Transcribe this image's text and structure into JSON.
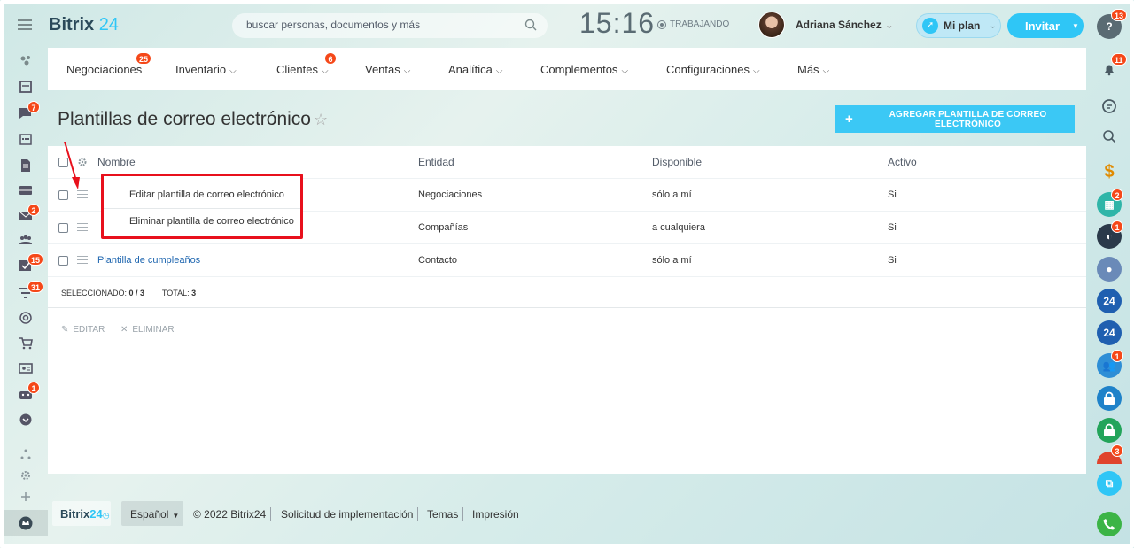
{
  "header": {
    "logo_text": "Bitrix",
    "logo_num": "24",
    "search_placeholder": "buscar personas, documentos y más",
    "clock": "15:16",
    "status": "TRABAJANDO",
    "user_name": "Adriana Sánchez",
    "plan_label": "Mi plan",
    "invite_label": "Invitar"
  },
  "nav": {
    "items": [
      {
        "label": "Negociaciones",
        "badge": "25"
      },
      {
        "label": "Inventario",
        "badge": ""
      },
      {
        "label": "Clientes",
        "badge": "6"
      },
      {
        "label": "Ventas",
        "badge": ""
      },
      {
        "label": "Analítica",
        "badge": ""
      },
      {
        "label": "Complementos",
        "badge": ""
      },
      {
        "label": "Configuraciones",
        "badge": ""
      },
      {
        "label": "Más",
        "badge": ""
      }
    ]
  },
  "page": {
    "title": "Plantillas de correo electrónico",
    "add_button": "AGREGAR PLANTILLA DE CORREO ELECTRÓNICO"
  },
  "grid": {
    "columns": [
      "Nombre",
      "Entidad",
      "Disponible",
      "Activo"
    ],
    "rows": [
      {
        "name": "",
        "entity": "Negociaciones",
        "available": "sólo a mí",
        "active": "Si"
      },
      {
        "name": "",
        "entity": "Compañías",
        "available": "a cualquiera",
        "active": "Si"
      },
      {
        "name": "Plantilla de cumpleaños",
        "entity": "Contacto",
        "available": "sólo a mí",
        "active": "Si"
      }
    ],
    "selected_label": "SELECCIONADO:",
    "selected_value": "0 / 3",
    "total_label": "TOTAL:",
    "total_value": "3",
    "action_edit": "EDITAR",
    "action_delete": "ELIMINAR"
  },
  "context_menu": {
    "edit": "Editar plantilla de correo electrónico",
    "delete": "Eliminar plantilla de correo electrónico"
  },
  "sidebar_left": {
    "badges": {
      "chat": "7",
      "mail": "2",
      "tasks": "15",
      "crm": "31",
      "robots": "1"
    }
  },
  "sidebar_right": {
    "badges": {
      "help": "13",
      "notifications": "11",
      "calendar": "2",
      "group": "1",
      "users": "1",
      "last": "3"
    },
    "bitrix_icon_text": "24"
  },
  "footer": {
    "logo_text": "Bitrix",
    "logo_num": "24",
    "language": "Español",
    "copyright": "© 2022 Bitrix24",
    "implementation": "Solicitud de implementación",
    "themes": "Temas",
    "print": "Impresión"
  },
  "colors": {
    "accent": "#2fc6f6",
    "badge": "#f54819",
    "link": "#2067b0",
    "highlight": "#e8101c"
  }
}
